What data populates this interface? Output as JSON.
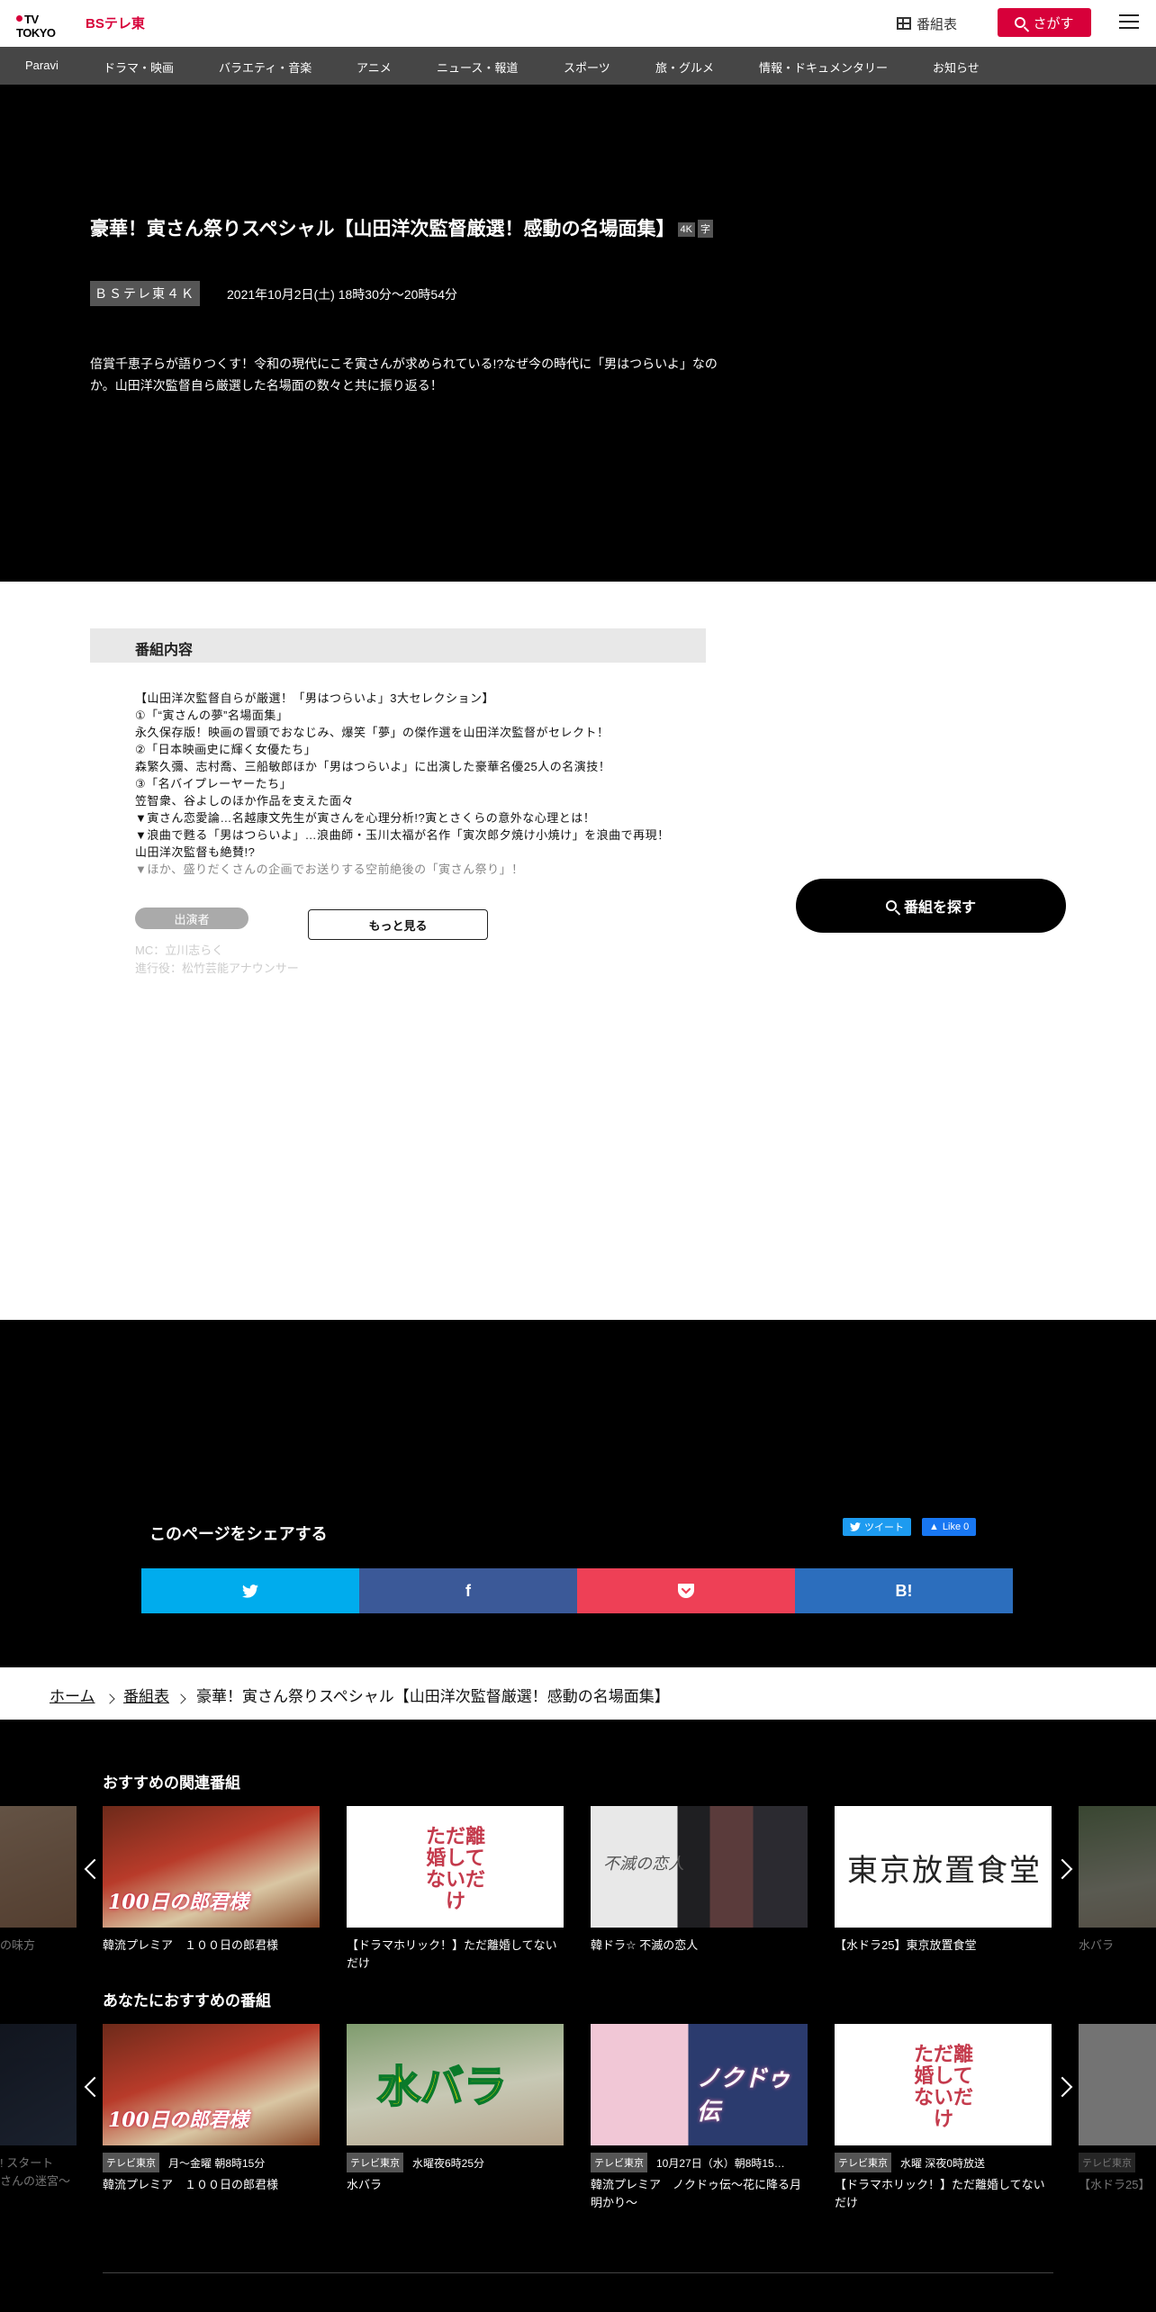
{
  "header": {
    "logo_main": "TV TOKYO",
    "logo_bs": "BSテレ東",
    "schedule_label": "番組表",
    "search_label": "さがす"
  },
  "nav": [
    "Paravi",
    "ドラマ・映画",
    "バラエティ・音楽",
    "アニメ",
    "ニュース・報道",
    "スポーツ",
    "旅・グルメ",
    "情報・ドキュメンタリー",
    "お知らせ"
  ],
  "program": {
    "title": "豪華！寅さん祭りスペシャル【山田洋次監督厳選！感動の名場面集】",
    "tags": [
      "4K",
      "字"
    ],
    "channel": "ＢＳテレ東４Ｋ",
    "air_time": "2021年10月2日(土) 18時30分～20時54分",
    "description": "倍賞千恵子らが語りつくす！令和の現代にこそ寅さんが求められている!?なぜ今の時代に「男はつらいよ」なのか。山田洋次監督自ら厳選した名場面の数々と共に振り返る！",
    "section_title": "番組内容",
    "body_lines": [
      "【山田洋次監督自らが厳選！「男はつらいよ」3大セレクション】",
      "①「“寅さんの夢”名場面集」",
      "永久保存版！映画の冒頭でおなじみ、爆笑「夢」の傑作選を山田洋次監督がセレクト！",
      "②「日本映画史に輝く女優たち」",
      "森繁久彌、志村喬、三船敏郎ほか「男はつらいよ」に出演した豪華名優25人の名演技！",
      "③「名バイプレーヤーたち」",
      "笠智衆、谷よしのほか作品を支えた面々",
      "▼寅さん恋愛論…名越康文先生が寅さんを心理分析!?寅とさくらの意外な心理とは！",
      "▼浪曲で甦る「男はつらいよ」…浪曲師・玉川太福が名作「寅次郎夕焼け小焼け」を浪曲で再現！山田洋次監督も絶賛!?",
      "▼ほか、盛りだくさんの企画でお送りする空前絶後の「寅さん祭り」！"
    ],
    "cast_label": "出演者",
    "more_label": "もっと見る",
    "cast_lines": [
      "MC：立川志らく",
      "進行役：松竹芸能アナウンサー"
    ],
    "find_label": "番組を探す"
  },
  "share": {
    "title": "このページをシェアする",
    "tweet_label": "ツイート",
    "like_label": "Like 0",
    "buttons": [
      {
        "name": "twitter",
        "label": "",
        "color": "#00aced"
      },
      {
        "name": "facebook",
        "label": "f",
        "color": "#3b5998"
      },
      {
        "name": "pocket",
        "label": "",
        "color": "#ee4056"
      },
      {
        "name": "hatena",
        "label": "B!",
        "color": "#2c6ebd"
      }
    ]
  },
  "breadcrumb": {
    "home": "ホーム",
    "schedule": "番組表",
    "current": "豪華！寅さん祭りスペシャル【山田洋次監督厳選！感動の名場面集】"
  },
  "related": {
    "title": "おすすめの関連番組",
    "prev_partial": "の味方",
    "next_partial": "水バラ",
    "items": [
      {
        "title": "韓流プレミア　１００日の郎君様",
        "art": "100日の郎君様"
      },
      {
        "title": "【ドラマホリック！】ただ離婚してないだけ",
        "art": "ただ離婚してないだけ"
      },
      {
        "title": "韓ドラ☆ 不滅の恋人",
        "art": "不滅の恋人"
      },
      {
        "title": "【水ドラ25】東京放置食堂",
        "art": "東京放置食堂"
      }
    ]
  },
  "recommended": {
    "title": "あなたにおすすめの番組",
    "prev_partial_lines": [
      "! スタート",
      "さんの迷宮～"
    ],
    "next_partial": "【水ドラ25】",
    "next_partial_badge": "テレビ東京",
    "items": [
      {
        "title": "韓流プレミア　１００日の郎君様",
        "network": "テレビ東京",
        "time": "月～金曜 朝8時15分",
        "art": "100日の郎君様"
      },
      {
        "title": "水バラ",
        "network": "テレビ東京",
        "time": "水曜夜6時25分",
        "art": "水バラ"
      },
      {
        "title": "韓流プレミア　ノクドゥ伝～花に降る月明かり～",
        "network": "テレビ東京",
        "time": "10月27日（水）朝8時15…",
        "art": "ノクドゥ伝"
      },
      {
        "title": "【ドラマホリック！】ただ離婚してないだけ",
        "network": "テレビ東京",
        "time": "水曜 深夜0時放送",
        "art": "ただ離婚してないだけ"
      }
    ]
  }
}
